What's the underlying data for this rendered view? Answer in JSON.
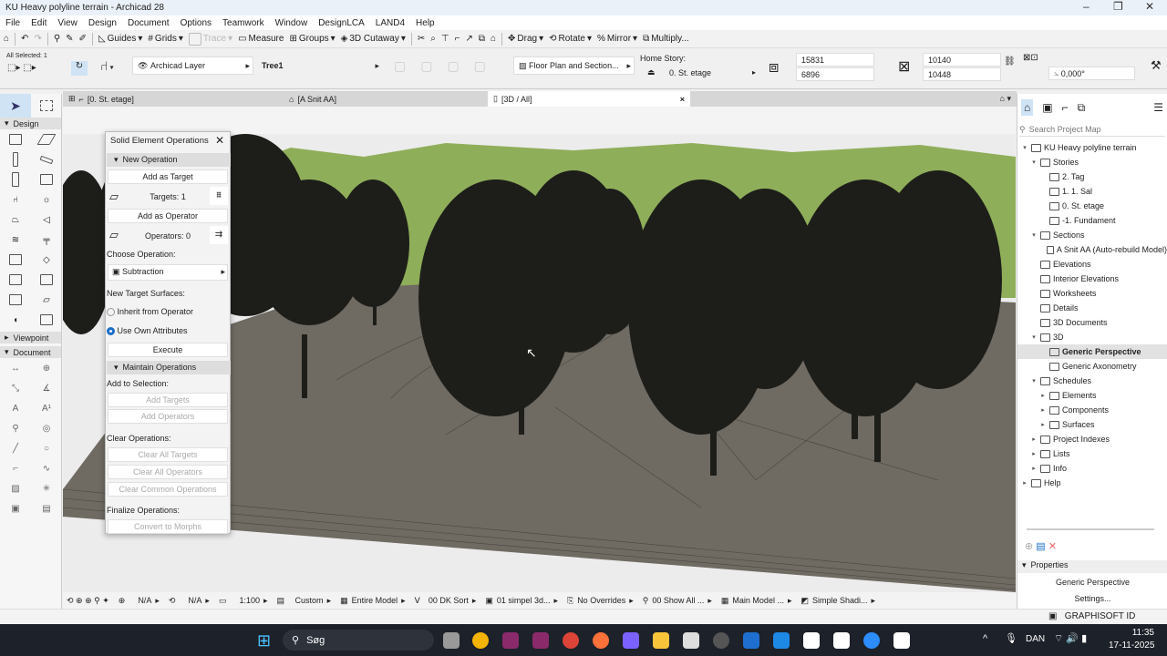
{
  "window": {
    "title": "KU Heavy polyline terrain - Archicad 28"
  },
  "menu": [
    "File",
    "Edit",
    "View",
    "Design",
    "Document",
    "Options",
    "Teamwork",
    "Window",
    "DesignLCA",
    "LAND4",
    "Help"
  ],
  "toolbar": {
    "guides": "Guides",
    "grids": "Grids",
    "trace": "Trace",
    "measure": "Measure",
    "groups": "Groups",
    "cutaway": "3D Cutaway",
    "drag": "Drag",
    "rotate": "Rotate",
    "mirror": "Mirror",
    "multiply": "Multiply..."
  },
  "infobox": {
    "selected": "All Selected: 1",
    "layer": "Archicad Layer",
    "element_id": "Tree1",
    "floor_plan": "Floor Plan and Section...",
    "home_story_label": "Home Story:",
    "home_story": "0. St. etage",
    "height1": "15831",
    "height2": "6896",
    "width1": "10140",
    "width2": "10448",
    "angle": "0,000°"
  },
  "tabs": [
    {
      "label": "[0. St. etage]"
    },
    {
      "label": "[A Snit AA]"
    },
    {
      "label": "[3D / All]"
    }
  ],
  "toolbox": {
    "select_arrow": "Arrow",
    "design": "Design",
    "viewpoint": "Viewpoint",
    "document": "Document"
  },
  "dialog": {
    "title": "Solid Element Operations",
    "new_operation": "New Operation",
    "add_target": "Add as Target",
    "targets": "Targets: 1",
    "add_operator": "Add as Operator",
    "operators": "Operators: 0",
    "choose_op": "Choose Operation:",
    "operation": "Subtraction",
    "new_surfaces": "New Target Surfaces:",
    "inherit": "Inherit from Operator",
    "use_own": "Use Own Attributes",
    "surface_choice": "use_own",
    "execute": "Execute",
    "maintain": "Maintain Operations",
    "add_to_sel": "Add to Selection:",
    "add_targets": "Add Targets",
    "add_operators": "Add Operators",
    "clear_ops": "Clear Operations:",
    "clear_targets": "Clear All Targets",
    "clear_operators": "Clear All Operators",
    "clear_common": "Clear Common Operations",
    "finalize": "Finalize Operations:",
    "convert": "Convert to Morphs"
  },
  "statusbar": {
    "na1": "N/A",
    "na2": "N/A",
    "scale": "1:100",
    "custom": "Custom",
    "model": "Entire Model",
    "pen": "00 DK Sort",
    "view": "01 simpel 3d...",
    "overrides": "No Overrides",
    "show": "00 Show All ...",
    "main": "Main Model ...",
    "shading": "Simple Shadi..."
  },
  "navigator": {
    "search_placeholder": "Search Project Map",
    "items": [
      {
        "label": "KU Heavy polyline terrain",
        "level": 0,
        "caret": "v"
      },
      {
        "label": "Stories",
        "level": 1,
        "caret": "v"
      },
      {
        "label": "2. Tag",
        "level": 2,
        "caret": ""
      },
      {
        "label": "1. 1. Sal",
        "level": 2,
        "caret": ""
      },
      {
        "label": "0. St. etage",
        "level": 2,
        "caret": ""
      },
      {
        "label": "-1. Fundament",
        "level": 2,
        "caret": ""
      },
      {
        "label": "Sections",
        "level": 1,
        "caret": "v"
      },
      {
        "label": "A Snit AA (Auto-rebuild Model)",
        "level": 2,
        "caret": ""
      },
      {
        "label": "Elevations",
        "level": 1,
        "caret": ""
      },
      {
        "label": "Interior Elevations",
        "level": 1,
        "caret": ""
      },
      {
        "label": "Worksheets",
        "level": 1,
        "caret": ""
      },
      {
        "label": "Details",
        "level": 1,
        "caret": ""
      },
      {
        "label": "3D Documents",
        "level": 1,
        "caret": ""
      },
      {
        "label": "3D",
        "level": 1,
        "caret": "v"
      },
      {
        "label": "Generic Perspective",
        "level": 2,
        "caret": "",
        "selected": true
      },
      {
        "label": "Generic Axonometry",
        "level": 2,
        "caret": ""
      },
      {
        "label": "Schedules",
        "level": 1,
        "caret": "v"
      },
      {
        "label": "Elements",
        "level": 2,
        "caret": ">"
      },
      {
        "label": "Components",
        "level": 2,
        "caret": ">"
      },
      {
        "label": "Surfaces",
        "level": 2,
        "caret": ">"
      },
      {
        "label": "Project Indexes",
        "level": 1,
        "caret": ">"
      },
      {
        "label": "Lists",
        "level": 1,
        "caret": ">"
      },
      {
        "label": "Info",
        "level": 1,
        "caret": ">"
      },
      {
        "label": "Help",
        "level": 0,
        "caret": ">"
      }
    ],
    "properties": "Properties",
    "prop_value": "Generic Perspective",
    "settings": "Settings..."
  },
  "graphisoft_id": "GRAPHISOFT ID",
  "taskbar": {
    "search": "Søg",
    "lang": "DAN",
    "time": "11:35",
    "date": "17-11-2025"
  }
}
